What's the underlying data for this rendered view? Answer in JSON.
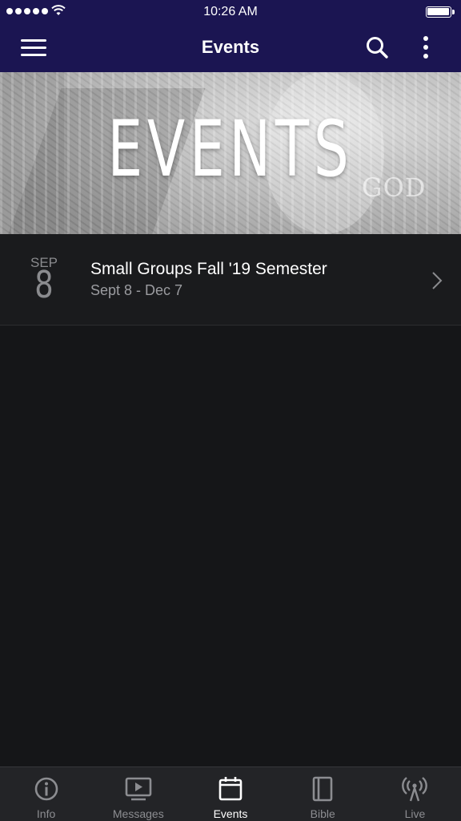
{
  "status_bar": {
    "time": "10:26 AM",
    "signal_icon": "signal-dots-icon",
    "wifi_icon": "wifi-icon",
    "battery_icon": "battery-icon"
  },
  "navbar": {
    "title": "Events",
    "menu_icon": "hamburger-menu-icon",
    "search_icon": "search-icon",
    "more_icon": "more-vertical-icon",
    "background_color": "#1b1552"
  },
  "banner": {
    "title": "EVENTS",
    "watermark": "GOD"
  },
  "events": [
    {
      "month": "SEP",
      "day": "8",
      "title": "Small Groups Fall '19 Semester",
      "dates": "Sept 8 - Dec 7"
    }
  ],
  "tabbar": {
    "active_color": "#ffffff",
    "inactive_color": "#8c8d91",
    "tabs": [
      {
        "label": "Info",
        "icon": "info-icon",
        "active": false
      },
      {
        "label": "Messages",
        "icon": "video-play-icon",
        "active": false
      },
      {
        "label": "Events",
        "icon": "calendar-icon",
        "active": true
      },
      {
        "label": "Bible",
        "icon": "book-icon",
        "active": false
      },
      {
        "label": "Live",
        "icon": "broadcast-icon",
        "active": false
      }
    ]
  }
}
